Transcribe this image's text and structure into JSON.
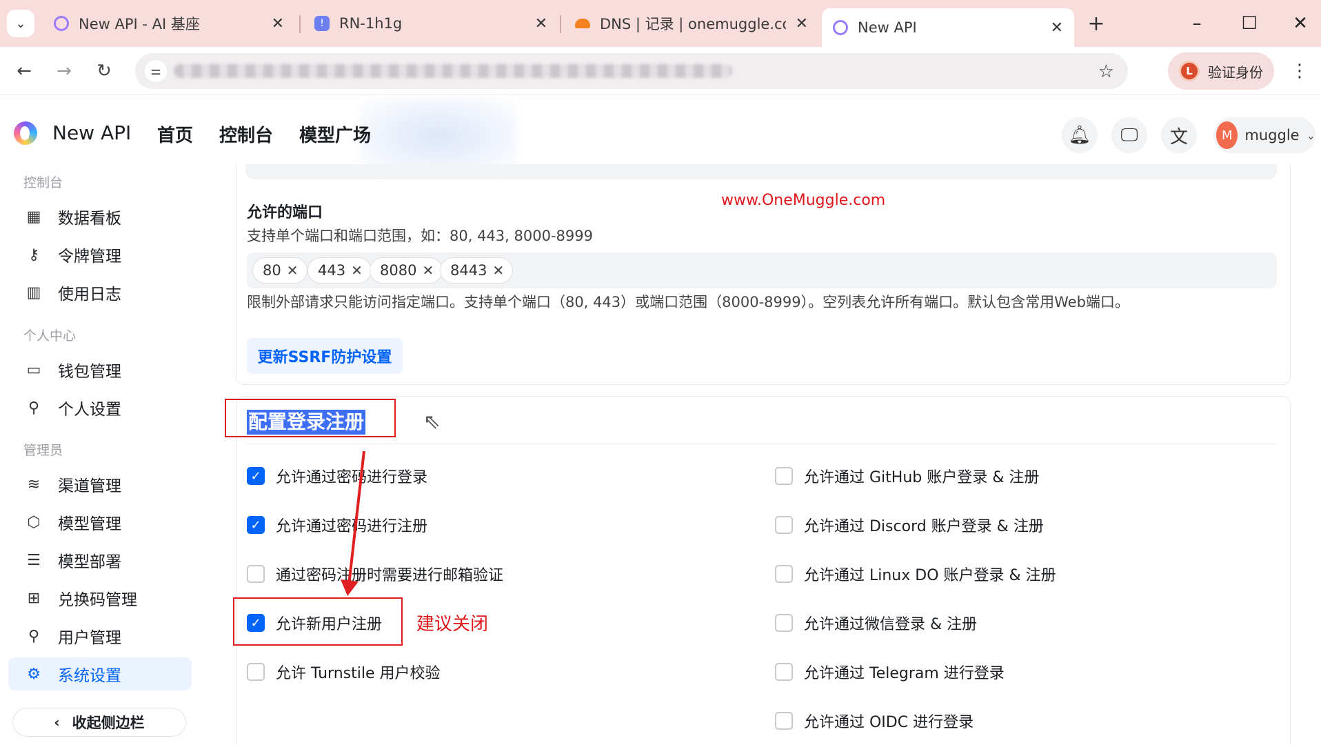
{
  "browser": {
    "tabs": [
      {
        "title": "New API - AI 基座",
        "active": false
      },
      {
        "title": "RN-1h1g",
        "active": false
      },
      {
        "title": "DNS | 记录 | onemuggle.con",
        "active": false
      },
      {
        "title": "New API",
        "active": true
      }
    ],
    "verify_label": "验证身份",
    "verify_badge": "L"
  },
  "header": {
    "brand": "New API",
    "nav": [
      "首页",
      "控制台",
      "模型广场"
    ],
    "user": {
      "initial": "M",
      "name": "muggle"
    }
  },
  "sidebar": {
    "groups": [
      {
        "title": "控制台",
        "items": [
          {
            "label": "数据看板",
            "icon": "dashboard-icon"
          },
          {
            "label": "令牌管理",
            "icon": "key-icon"
          },
          {
            "label": "使用日志",
            "icon": "chart-icon"
          }
        ]
      },
      {
        "title": "个人中心",
        "items": [
          {
            "label": "钱包管理",
            "icon": "wallet-icon"
          },
          {
            "label": "个人设置",
            "icon": "user-icon"
          }
        ]
      },
      {
        "title": "管理员",
        "items": [
          {
            "label": "渠道管理",
            "icon": "layers-icon"
          },
          {
            "label": "模型管理",
            "icon": "box-icon"
          },
          {
            "label": "模型部署",
            "icon": "server-icon"
          },
          {
            "label": "兑换码管理",
            "icon": "gift-icon"
          },
          {
            "label": "用户管理",
            "icon": "user-icon"
          },
          {
            "label": "系统设置",
            "icon": "gear-icon",
            "active": true
          }
        ]
      }
    ],
    "collapse_label": "收起侧边栏"
  },
  "ports": {
    "title": "允许的端口",
    "description": "支持单个端口和端口范围，如：80, 443, 8000-8999",
    "tags": [
      "80",
      "443",
      "8080",
      "8443"
    ],
    "hint": "限制外部请求只能访问指定端口。支持单个端口（80, 443）或端口范围（8000-8999）。空列表允许所有端口。默认包含常用Web端口。",
    "update_button": "更新SSRF防护设置"
  },
  "watermark": "www.OneMuggle.com",
  "login": {
    "title": "配置登录注册",
    "annotation": "建议关闭",
    "left_options": [
      {
        "label": "允许通过密码进行登录",
        "checked": true
      },
      {
        "label": "允许通过密码进行注册",
        "checked": true
      },
      {
        "label": "通过密码注册时需要进行邮箱验证",
        "checked": false
      },
      {
        "label": "允许新用户注册",
        "checked": true
      },
      {
        "label": "允许 Turnstile 用户校验",
        "checked": false
      }
    ],
    "right_options": [
      {
        "label": "允许通过 GitHub 账户登录 & 注册",
        "checked": false
      },
      {
        "label": "允许通过 Discord 账户登录 & 注册",
        "checked": false
      },
      {
        "label": "允许通过 Linux DO 账户登录 & 注册",
        "checked": false
      },
      {
        "label": "允许通过微信登录 & 注册",
        "checked": false
      },
      {
        "label": "允许通过 Telegram 进行登录",
        "checked": false
      },
      {
        "label": "允许通过 OIDC 进行登录",
        "checked": false
      }
    ]
  }
}
